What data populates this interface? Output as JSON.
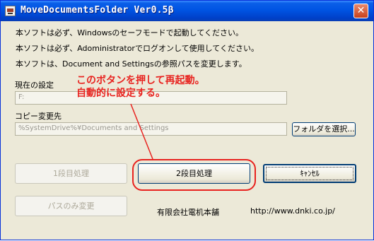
{
  "window": {
    "title": "MoveDocumentsFolder Ver0.5β",
    "close_glyph": "✕"
  },
  "notes": [
    "本ソフトは必ず、Windowsのセーフモードで起動してください。",
    "本ソフトは必ず、Adoministratorでログオンして使用してください。",
    "本ソフトは、Document and Settingsの参照パスを変更します。"
  ],
  "current_setting": {
    "label": "現在の設定",
    "value": "F:"
  },
  "copy_destination": {
    "label": "コピー変更先",
    "value": "%SystemDrive%¥Documents and Settings"
  },
  "buttons": {
    "select_folder": "フォルダを選択...",
    "stage1": "1段目処理",
    "stage2": "2段目処理",
    "cancel": "ｷｬﾝｾﾙ",
    "path_only": "パスのみ変更"
  },
  "annotation": {
    "line1": "このボタンを押して再起動。",
    "line2": "自動的に設定する。",
    "color": "#e8231f"
  },
  "footer": {
    "company": "有限会社電机本舗",
    "url": "http://www.dnki.co.jp/"
  }
}
